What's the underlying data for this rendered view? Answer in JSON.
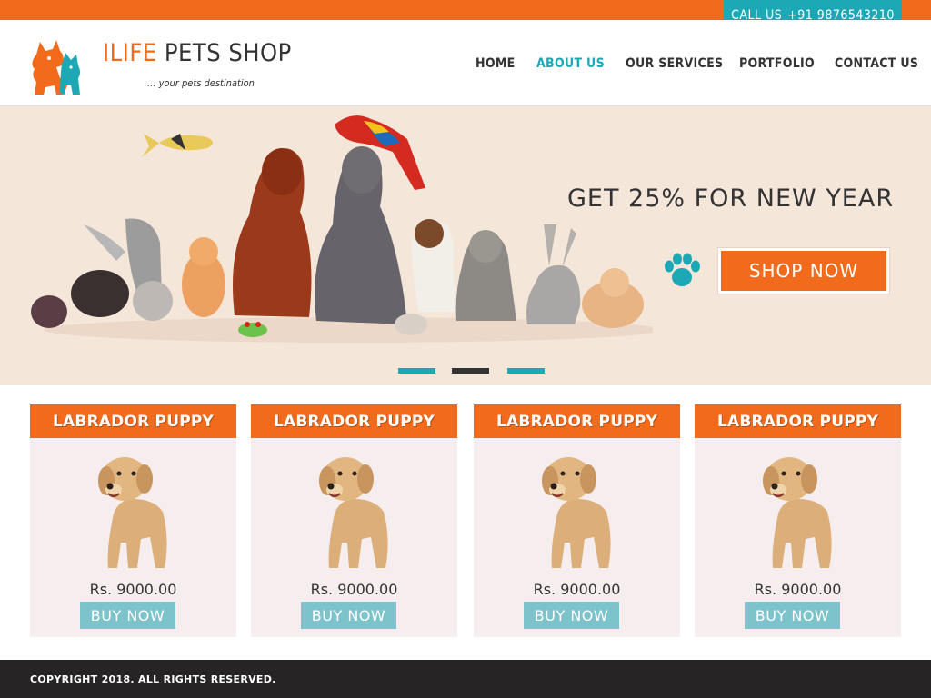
{
  "topbar": {
    "call_label": "CALL US",
    "phone": "+91 9876543210"
  },
  "header": {
    "brand_accent": "ILIFE",
    "brand_rest": "PETS SHOP",
    "tagline": "... your pets destination"
  },
  "nav": {
    "items": [
      {
        "label": "HOME",
        "active": false
      },
      {
        "label": "ABOUT US",
        "active": true
      },
      {
        "label": "OUR SERVICES",
        "active": false
      },
      {
        "label": "PORTFOLIO",
        "active": false
      },
      {
        "label": "CONTACT US",
        "active": false
      }
    ]
  },
  "hero": {
    "promo_text": "GET 25% FOR NEW YEAR",
    "shop_button": "SHOP NOW",
    "slides": 3,
    "active_slide": 2
  },
  "products": [
    {
      "title": "LABRADOR PUPPY",
      "price": "Rs. 9000.00",
      "button": "BUY NOW"
    },
    {
      "title": "LABRADOR PUPPY",
      "price": "Rs. 9000.00",
      "button": "BUY NOW"
    },
    {
      "title": "LABRADOR PUPPY",
      "price": "Rs. 9000.00",
      "button": "BUY NOW"
    },
    {
      "title": "LABRADOR PUPPY",
      "price": "Rs. 9000.00",
      "button": "BUY NOW"
    }
  ],
  "footer": {
    "copyright": "COPYRIGHT 2018. ALL RIGHTS RESERVED."
  },
  "colors": {
    "brand_orange": "#f26a1b",
    "brand_teal": "#1ca8b5",
    "hero_bg": "#f5e6da",
    "footer_bg": "#262424",
    "buy_button": "#7cc3cc"
  },
  "icons": {
    "logo": "dog-cat-logo-icon",
    "paw": "paw-icon",
    "product_image": "labrador-puppy-image"
  }
}
